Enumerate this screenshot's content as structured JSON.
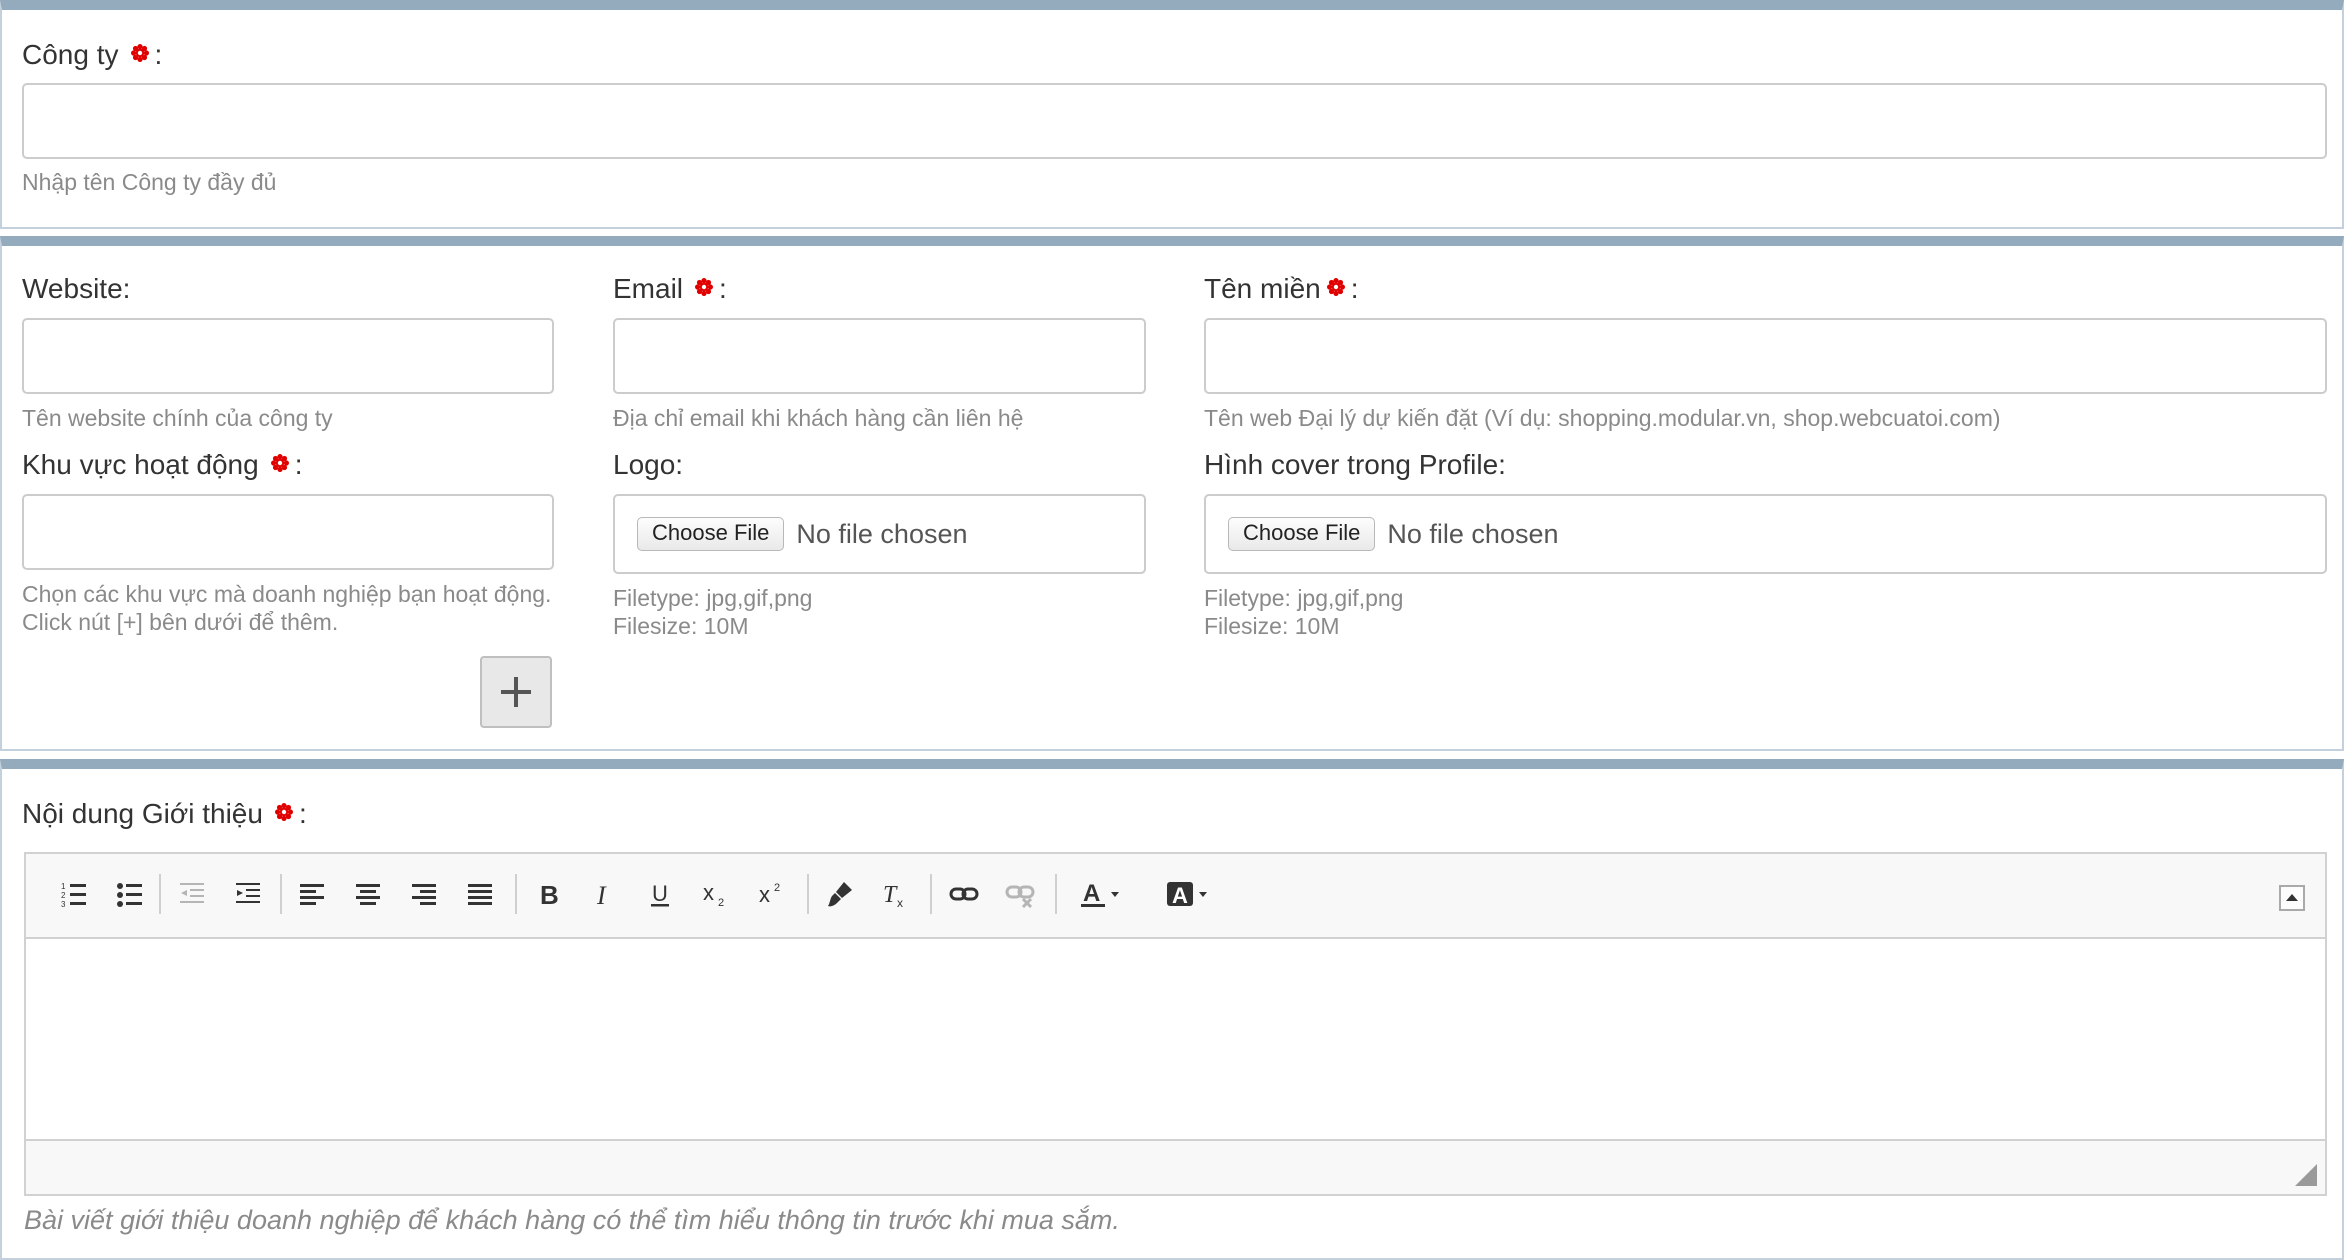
{
  "company": {
    "label": "Công ty",
    "label_suffix": ":",
    "help": "Nhập tên Công ty đầy đủ"
  },
  "website": {
    "label": "Website:",
    "help": "Tên website chính của công ty"
  },
  "email": {
    "label": "Email",
    "label_suffix": ":",
    "help": "Địa chỉ email khi khách hàng cần liên hệ"
  },
  "domain": {
    "label": "Tên miền",
    "label_suffix": ":",
    "help": "Tên web Đại lý dự kiến đặt (Ví dụ: shopping.modular.vn, shop.webcuatoi.com)"
  },
  "region": {
    "label": "Khu vực hoạt động",
    "label_suffix": ":",
    "help_line1": "Chọn các khu vực mà doanh nghiệp bạn hoạt động.",
    "help_line2": "Click nút [+] bên dưới để thêm."
  },
  "logo": {
    "label": "Logo:",
    "button": "Choose File",
    "status": "No file chosen",
    "filetype": "Filetype: jpg,gif,png",
    "filesize": "Filesize: 10M"
  },
  "cover": {
    "label": "Hình cover trong Profile:",
    "button": "Choose File",
    "status": "No file chosen",
    "filetype": "Filetype: jpg,gif,png",
    "filesize": "Filesize: 10M"
  },
  "intro": {
    "label": "Nội dung Giới thiệu",
    "label_suffix": ":",
    "help": "Bài viết giới thiệu doanh nghiệp để khách hàng có thể tìm hiểu thông tin trước khi mua sắm."
  },
  "colors": {
    "panel_top_border": "#94aabd",
    "required_asterisk": "#e00000",
    "help_text": "#8a8a8a"
  }
}
